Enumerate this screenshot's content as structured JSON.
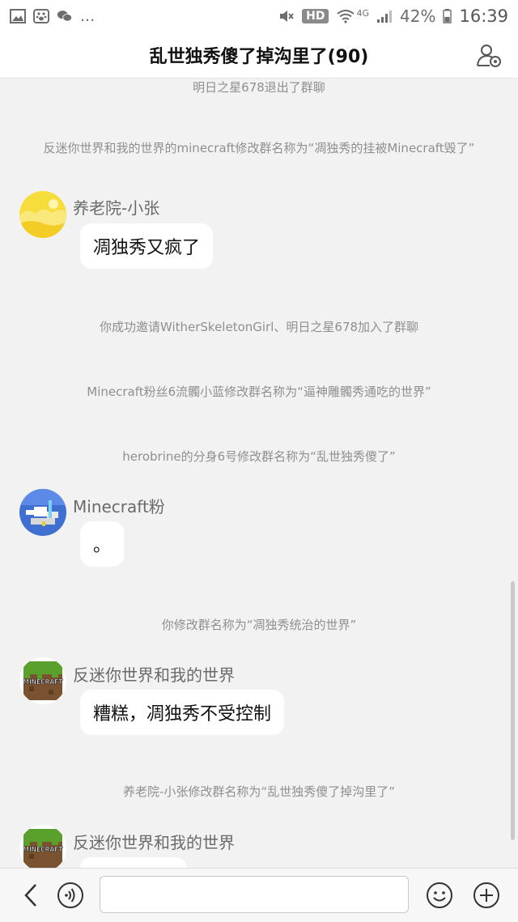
{
  "status_bar": {
    "more": "...",
    "hd": "HD",
    "network": "4G",
    "battery": "42%",
    "time": "16:39"
  },
  "header": {
    "title": "乱世独秀傻了掉沟里了(90)"
  },
  "messages": {
    "sys1": "明日之星678退出了群聊",
    "sys2": "反迷你世界和我的世界的minecraft修改群名称为“凋独秀的挂被Minecraft毁了”",
    "msg1": {
      "sender": "养老院-小张",
      "text": "凋独秀又疯了"
    },
    "sys3": "你成功邀请WitherSkeletonGirl、明日之星678加入了群聊",
    "sys4": "Minecraft粉丝6流髑小蓝修改群名称为“逼神雕髑秀通吃的世界”",
    "sys5": "herobrine的分身6号修改群名称为“乱世独秀傻了”",
    "msg2": {
      "sender": "Minecraft粉",
      "text": "。"
    },
    "sys6": "你修改群名称为“凋独秀统治的世界”",
    "msg3": {
      "sender": "反迷你世界和我的世界",
      "text": "糟糕，凋独秀不受控制"
    },
    "sys7": "养老院-小张修改群名称为“乱世独秀傻了掉沟里了”",
    "msg4": {
      "sender": "反迷你世界和我的世界",
      "text": ""
    }
  },
  "avatar_logo_text": "MINECRAFT",
  "input_bar": {
    "value": "",
    "placeholder": ""
  },
  "colors": {
    "background": "#f2f2f2",
    "bubble": "#ffffff",
    "system_text": "#8f8f8f",
    "sender_text": "#6a6a6a"
  },
  "icons": {
    "status_left": [
      "gallery-icon",
      "baidu-paw-icon",
      "wechat-icon"
    ],
    "status_right": [
      "mute-icon",
      "wifi-icon",
      "signal-icon",
      "battery-icon"
    ],
    "header": "group-profile-icon",
    "input_bar": [
      "back-icon",
      "voice-icon",
      "emoji-icon",
      "plus-icon"
    ]
  }
}
